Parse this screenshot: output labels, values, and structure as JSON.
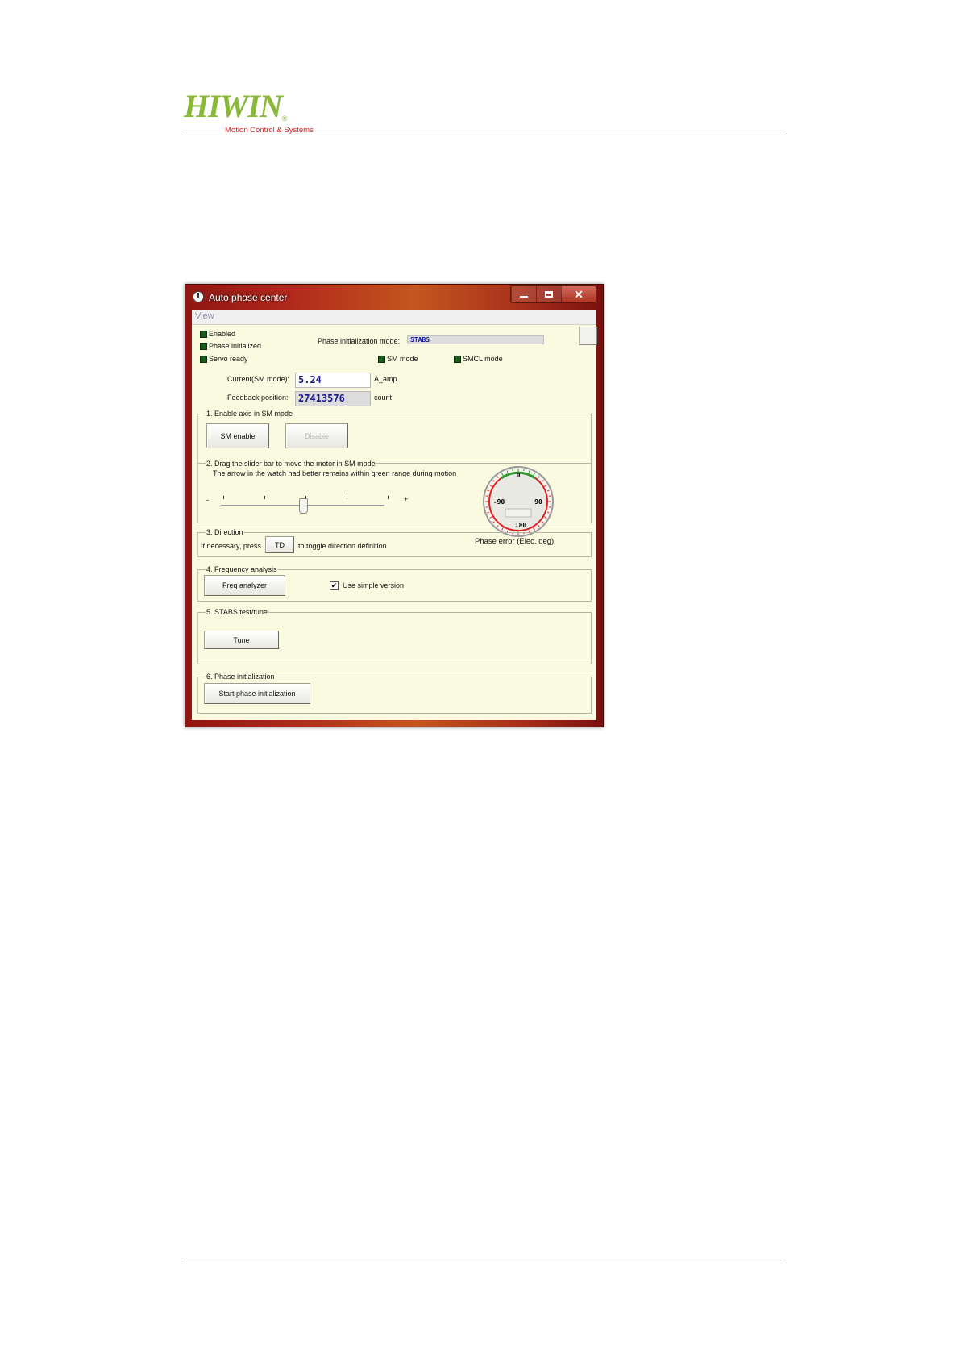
{
  "header": {
    "logo_text": "HIWIN",
    "logo_registered": "®",
    "logo_tagline": "Motion Control & Systems"
  },
  "window": {
    "title": "Auto phase center",
    "menu": [
      "View"
    ]
  },
  "status": {
    "enabled": "Enabled",
    "phase_initialized": "Phase initialized",
    "servo_ready": "Servo ready",
    "sm_mode": "SM mode",
    "smcl_mode": "SMCL mode",
    "phase_init_mode_label": "Phase initialization mode:",
    "phase_init_mode_value": "STABS"
  },
  "fields": {
    "current_label": "Current(SM mode):",
    "current_value": "5.24",
    "current_unit": "A_amp",
    "feedback_label": "Feedback position:",
    "feedback_value": "27413576",
    "feedback_unit": "count"
  },
  "section1": {
    "title": "1. Enable axis in SM mode",
    "enable_button": "SM enable",
    "disable_button": "Disable"
  },
  "section2": {
    "title": "2. Drag the slider bar to move the motor in SM mode",
    "hint": "The arrow in the watch had better remains within green range during motion",
    "minus": "-",
    "plus": "+",
    "slider_level": 0.5
  },
  "gauge": {
    "top": "0",
    "left": "-90",
    "right": "90",
    "bottom": "180",
    "caption": "Phase error (Elec. deg)",
    "green_color": "#2e9a2e",
    "red_color": "#e02020"
  },
  "section3": {
    "title": "3. Direction",
    "prefix": "If necessary, press",
    "button": "TD",
    "suffix": "to toggle direction definition"
  },
  "section4": {
    "title": "4. Frequency analysis",
    "button": "Freq analyzer",
    "checkbox_label": "Use simple version",
    "checkbox_mark": "✔"
  },
  "section5": {
    "title": "5. STABS test/tune",
    "button": "Tune"
  },
  "section6": {
    "title": "6. Phase initialization",
    "button": "Start phase initialization"
  }
}
